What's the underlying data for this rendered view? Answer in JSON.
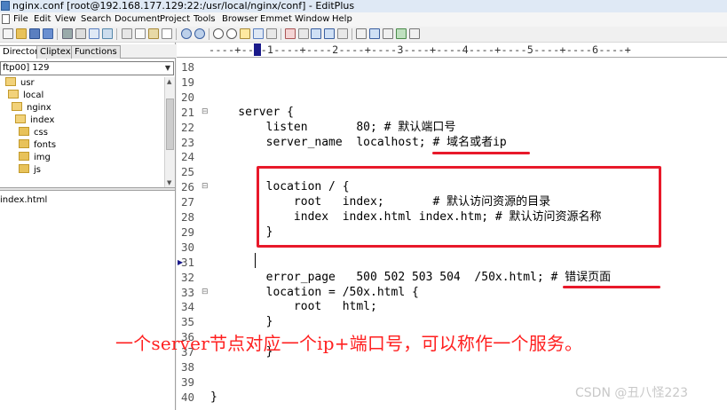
{
  "window": {
    "title": "nginx.conf [root@192.168.177.129:22:/usr/local/nginx/conf] - EditPlus"
  },
  "menu": [
    "File",
    "Edit",
    "View",
    "Search",
    "Document",
    "Project",
    "Tools",
    "Browser",
    "Emmet",
    "Window",
    "Help"
  ],
  "sidebar": {
    "tabs": [
      "Directory",
      "Cliptext",
      "Functions"
    ],
    "active_tab": "Directory",
    "selected_dir": "ftp00] 129",
    "tree": [
      {
        "label": "usr",
        "open": true
      },
      {
        "label": "local",
        "open": true
      },
      {
        "label": "nginx",
        "open": true
      },
      {
        "label": "index",
        "open": true,
        "selected": true
      },
      {
        "label": "css",
        "open": false
      },
      {
        "label": "fonts",
        "open": false
      },
      {
        "label": "img",
        "open": false
      },
      {
        "label": "js",
        "open": false
      }
    ],
    "files": [
      "index.html"
    ]
  },
  "ruler": {
    "text": "----+----1----+----2----+----3----+----4----+----5----+----6----+"
  },
  "editor": {
    "lines": [
      {
        "n": "18",
        "text": ""
      },
      {
        "n": "19",
        "text": ""
      },
      {
        "n": "20",
        "text": ""
      },
      {
        "n": "21",
        "text": "    server {",
        "fold": true
      },
      {
        "n": "22",
        "text": "        listen       80; # 默认端口号"
      },
      {
        "n": "23",
        "text": "        server_name  localhost; # 域名或者ip"
      },
      {
        "n": "24",
        "text": ""
      },
      {
        "n": "25",
        "text": ""
      },
      {
        "n": "26",
        "text": "        location / {",
        "fold": true
      },
      {
        "n": "27",
        "text": "            root   index;       # 默认访问资源的目录"
      },
      {
        "n": "28",
        "text": "            index  index.html index.htm; # 默认访问资源名称"
      },
      {
        "n": "29",
        "text": "        }"
      },
      {
        "n": "30",
        "text": ""
      },
      {
        "n": "31",
        "text": "",
        "bookmark": true
      },
      {
        "n": "32",
        "text": "        error_page   500 502 503 504  /50x.html; # 错误页面"
      },
      {
        "n": "33",
        "text": "        location = /50x.html {",
        "fold": true
      },
      {
        "n": "34",
        "text": "            root   html;"
      },
      {
        "n": "35",
        "text": "        }"
      },
      {
        "n": "36",
        "text": ""
      },
      {
        "n": "37",
        "text": "        }"
      },
      {
        "n": "38",
        "text": ""
      },
      {
        "n": "39",
        "text": ""
      },
      {
        "n": "40",
        "text": "}"
      }
    ]
  },
  "overlay": {
    "caption": "一个server节点对应一个ip+端口号，可以称作一个服务。"
  },
  "watermark": "CSDN @丑八怪223",
  "colors": {
    "annotation": "#e8192a",
    "caption": "#ff1f1f"
  }
}
